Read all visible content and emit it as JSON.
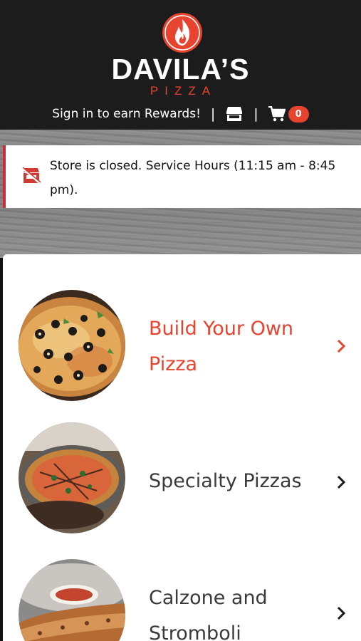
{
  "header": {
    "brand_name": "DAVILA’S",
    "brand_sub": "PIZZA",
    "signin_text": "Sign in to earn Rewards!",
    "separator": "|",
    "cart_count": "0",
    "brand_color": "#e8432e",
    "icons": [
      "flame-logo-icon",
      "store-icon",
      "cart-icon"
    ]
  },
  "notice": {
    "text": "Store is closed. Service Hours (11:15 am - 8:45 pm).",
    "icon": "store-closed-icon",
    "accent_color": "#c4303a"
  },
  "menu": {
    "items": [
      {
        "label": "Build Your Own Pizza",
        "color": "#e8432e",
        "icon": "chevron-right-icon"
      },
      {
        "label": "Specialty Pizzas",
        "color": "#3a3a3a",
        "icon": "chevron-right-icon"
      },
      {
        "label": "Calzone and Stromboli",
        "color": "#3a3a3a",
        "icon": "chevron-right-icon"
      }
    ]
  }
}
